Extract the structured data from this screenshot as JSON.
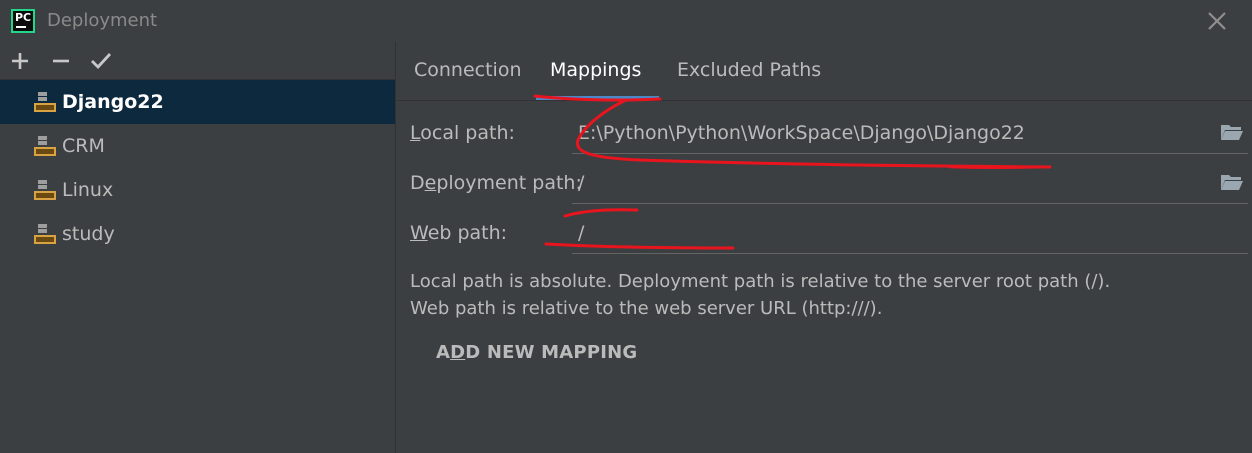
{
  "window": {
    "app_icon": "pycharm-logo",
    "app_icon_text": "PC",
    "title": "Deployment",
    "close_icon": "close-icon"
  },
  "toolbar": {
    "add_icon": "plus-icon",
    "remove_icon": "minus-icon",
    "default_icon": "checkmark-icon"
  },
  "servers": [
    {
      "label": "Django22",
      "selected": true,
      "icon": "sftp-server-icon"
    },
    {
      "label": "CRM",
      "selected": false,
      "icon": "sftp-server-icon"
    },
    {
      "label": "Linux",
      "selected": false,
      "icon": "sftp-server-icon"
    },
    {
      "label": "study",
      "selected": false,
      "icon": "sftp-server-icon"
    }
  ],
  "tabs": [
    {
      "label": "Connection",
      "active": false
    },
    {
      "label": "Mappings",
      "active": true
    },
    {
      "label": "Excluded Paths",
      "active": false
    }
  ],
  "mappings": {
    "local_path": {
      "label_mnemonic": "L",
      "label_rest": "ocal path:",
      "value": "E:\\Python\\Python\\WorkSpace\\Django\\Django22"
    },
    "deployment_path": {
      "label_pre": "D",
      "label_mnemonic": "e",
      "label_rest": "ployment path:",
      "value": "/"
    },
    "web_path": {
      "label_mnemonic": "W",
      "label_rest": "eb path:",
      "value": "/"
    }
  },
  "hint": {
    "line1": "Local path is absolute. Deployment path is relative to the server root path (/).",
    "line2": "Web path is relative to the web server URL (http:///)."
  },
  "add_mapping": {
    "pre": "A",
    "mnemonic": "D",
    "rest": "D NEW MAPPING"
  },
  "colors": {
    "background": "#3c3f41",
    "selection": "#0d293e",
    "accent": "#4a88c7",
    "annotation": "#e8141e"
  }
}
